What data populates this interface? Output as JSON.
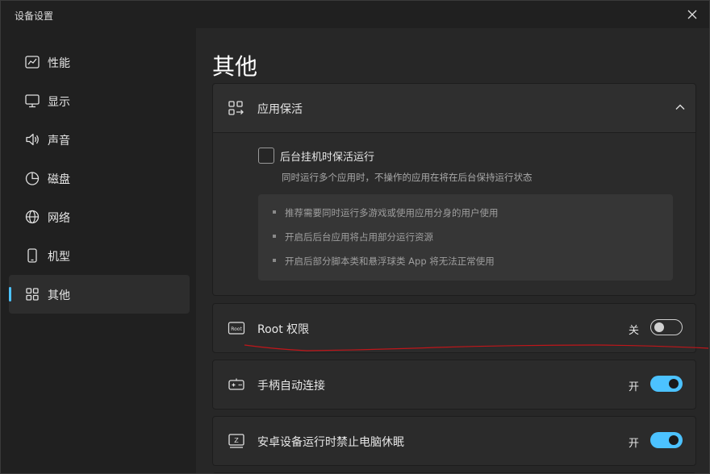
{
  "window": {
    "title": "设备设置"
  },
  "sidebar": {
    "items": [
      {
        "label": "性能",
        "icon": "performance-chart-icon"
      },
      {
        "label": "显示",
        "icon": "monitor-icon"
      },
      {
        "label": "声音",
        "icon": "speaker-icon"
      },
      {
        "label": "磁盘",
        "icon": "pie-chart-icon"
      },
      {
        "label": "网络",
        "icon": "globe-icon"
      },
      {
        "label": "机型",
        "icon": "phone-icon"
      },
      {
        "label": "其他",
        "icon": "grid-icon",
        "active": true
      }
    ]
  },
  "main": {
    "title": "其他",
    "keepalive": {
      "label": "应用保活",
      "icon": "grid-arrow-icon",
      "expanded": true,
      "checkbox_label": "后台挂机时保活运行",
      "checked": false,
      "description": "同时运行多个应用时，不操作的应用在将在后台保持运行状态",
      "notes": [
        "推荐需要同时运行多游戏或使用应用分身的用户使用",
        "开启后后台应用将占用部分运行资源",
        "开启后部分脚本类和悬浮球类 App 将无法正常使用"
      ]
    },
    "root": {
      "label": "Root 权限",
      "icon_text": "Root",
      "state": "关",
      "on": false
    },
    "gamepad": {
      "label": "手柄自动连接",
      "icon": "gamepad-icon",
      "state": "开",
      "on": true
    },
    "sleep": {
      "label": "安卓设备运行时禁止电脑休眠",
      "icon": "sleep-icon",
      "icon_text": "Z",
      "state": "开",
      "on": true
    }
  },
  "colors": {
    "accent": "#4cc2ff",
    "annotation": "#c0161a"
  }
}
